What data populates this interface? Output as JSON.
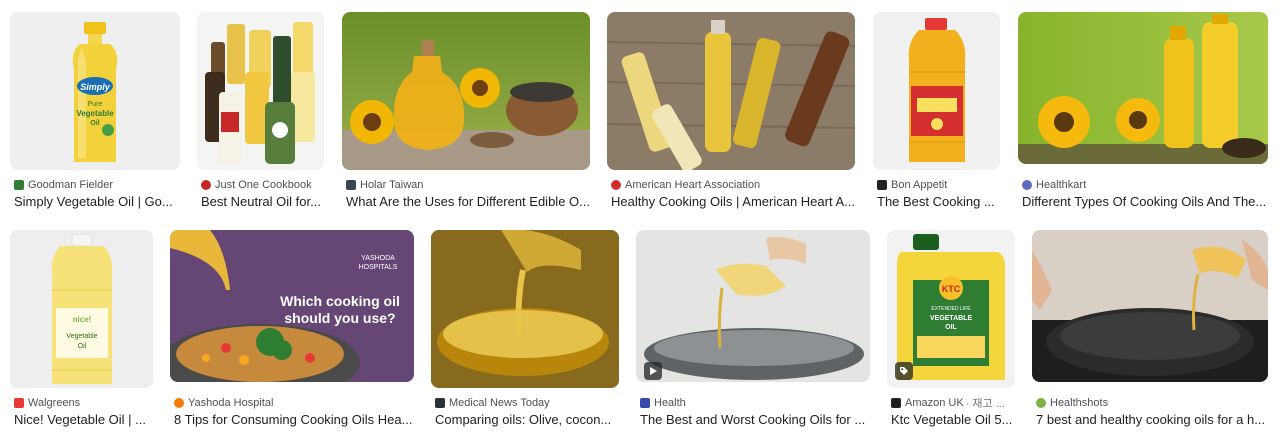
{
  "results": [
    {
      "source": "Goodman Fielder",
      "title": "Simply Vegetable Oil | Go...",
      "favicon": "goodman-fielder-favicon",
      "fav_color": "#2e7d32"
    },
    {
      "source": "Just One Cookbook",
      "title": "Best Neutral Oil for...",
      "favicon": "just-one-cookbook-favicon",
      "fav_color": "#c62828"
    },
    {
      "source": "Holar Taiwan",
      "title": "What Are the Uses for Different Edible O...",
      "favicon": "holar-taiwan-favicon",
      "fav_color": "#37474f"
    },
    {
      "source": "American Heart Association",
      "title": "Healthy Cooking Oils | American Heart A...",
      "favicon": "aha-heart-favicon",
      "fav_color": "#d32f2f"
    },
    {
      "source": "Bon Appetit",
      "title": "The Best Cooking ...",
      "favicon": "bon-appetit-favicon",
      "fav_color": "#212121"
    },
    {
      "source": "Healthkart",
      "title": "Different Types Of Cooking Oils And The...",
      "favicon": "healthkart-favicon",
      "fav_color": "#5c6bc0"
    },
    {
      "source": "Walgreens",
      "title": "Nice! Vegetable Oil | ...",
      "favicon": "walgreens-favicon",
      "fav_color": "#e53935"
    },
    {
      "source": "Yashoda Hospital",
      "title": "8 Tips for Consuming Cooking Oils Hea...",
      "favicon": "yashoda-favicon",
      "fav_color": "#f57c00"
    },
    {
      "source": "Medical News Today",
      "title": "Comparing oils: Olive, cocon...",
      "favicon": "mnt-favicon",
      "fav_color": "#263238"
    },
    {
      "source": "Health",
      "title": "The Best and Worst Cooking Oils for ...",
      "favicon": "health-favicon",
      "fav_color": "#3949ab"
    },
    {
      "source": "Amazon UK",
      "source_extra": "· 재고 ...",
      "title": "Ktc Vegetable Oil 5...",
      "favicon": "amazon-favicon",
      "fav_color": "#212121"
    },
    {
      "source": "Healthshots",
      "title": "7 best and healthy cooking oils for a h...",
      "favicon": "healthshots-favicon",
      "fav_color": "#7cb342"
    }
  ],
  "overlay_text": {
    "yashoda_logo": "YASHODA\nHOSPITALS",
    "yashoda_question_1": "Which cooking oil",
    "yashoda_question_2": "should you use?",
    "simply_brand": "Simply",
    "simply_pure": "Pure",
    "simply_product": "Vegetable",
    "simply_oil": "Oil",
    "nice_label": "nice!",
    "nice_product": "Vegetable",
    "nice_oil": "Oil",
    "ktc_brand": "KTC",
    "ktc_line1": "EXTENDED LIFE",
    "ktc_line2": "VEGETABLE",
    "ktc_line3": "OIL"
  },
  "icons": {
    "video": "play-icon",
    "product": "tag-icon"
  }
}
